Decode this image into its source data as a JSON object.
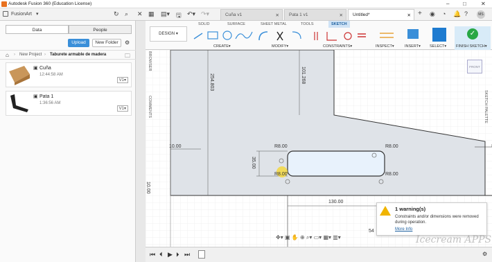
{
  "title": "Autodesk Fusion 360 (Education License)",
  "team": "FusionArt",
  "tabs": [
    "Cuña v1",
    "Pata 1 v1",
    "Untitled*"
  ],
  "panel": {
    "seg_data": "Data",
    "seg_people": "People",
    "upload": "Upload",
    "new_folder": "New Folder",
    "breadcrumb_project": "New Project",
    "breadcrumb_folder": "Taburete armable de madera",
    "items": [
      {
        "name": "Cuña",
        "time": "12:44:58 AM",
        "version": "V1"
      },
      {
        "name": "Pata 1",
        "time": "1:36:56 AM",
        "version": "V1"
      }
    ]
  },
  "ribbon": {
    "workspace": "DESIGN",
    "tabs": [
      "SOLID",
      "SURFACE",
      "SHEET METAL",
      "TOOLS",
      "SKETCH"
    ],
    "groups": [
      "CREATE",
      "MODIFY",
      "CONSTRAINTS",
      "INSPECT",
      "INSERT",
      "SELECT",
      "FINISH SKETCH"
    ]
  },
  "side": {
    "browser": "BROWSER",
    "comments": "COMMENTS",
    "palette": "SKETCH PALETTE"
  },
  "viewcube": "FRONT",
  "dims": {
    "d1": "254.803",
    "d2": "101.268",
    "d3": "10.00",
    "d4": "R8.00",
    "d5": "R8.00",
    "d6": "35.00",
    "d7": "R8.00",
    "d8": "R8.00",
    "d9": "130.00",
    "d10": "10.00",
    "d11": "54"
  },
  "warning": {
    "title": "1 warning(s)",
    "message": "Constraints and/or dimensions were removed during operation.",
    "link": "More Info"
  },
  "watermark": "Icecream APPS",
  "colors": {
    "accent": "#3a8fd9",
    "sketch_fill": "#dfe3e8",
    "finish": "#28a745"
  }
}
